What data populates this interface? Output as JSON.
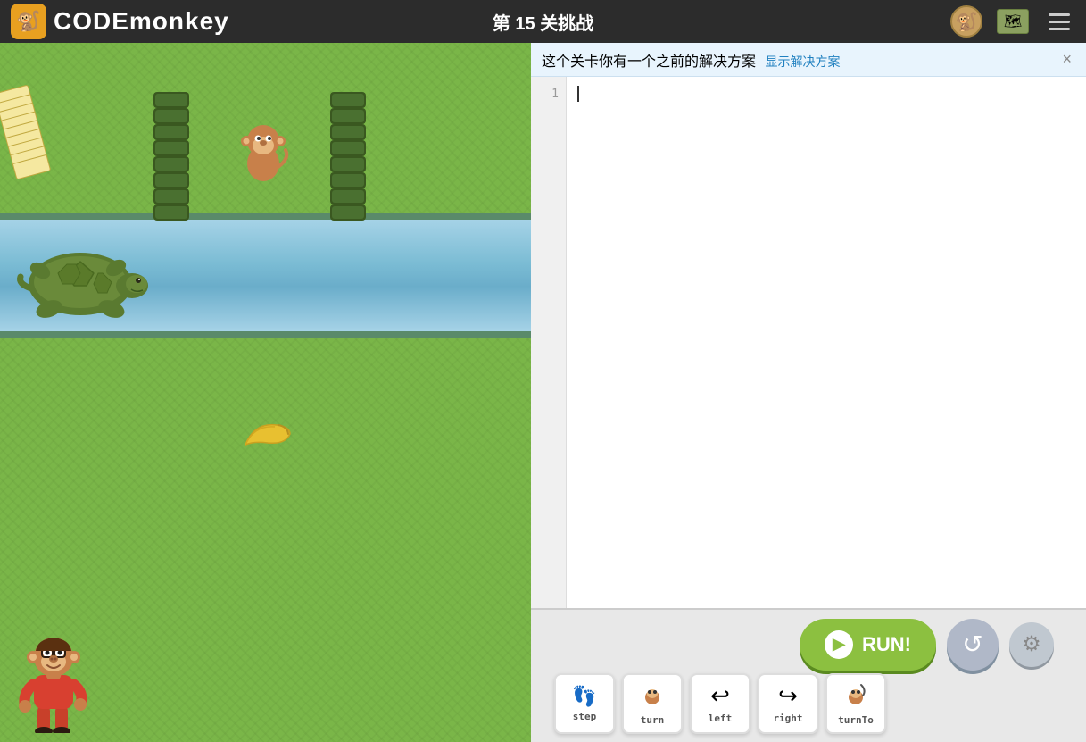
{
  "header": {
    "logo_monkey": "🐒",
    "logo_code": "CODE",
    "logo_monkey2": "monkey",
    "level_label": "第",
    "level_number": "15",
    "level_suffix": "关挑战"
  },
  "notification": {
    "text": "这个关卡你有一个之前的解决方案",
    "link_text": "显示解决方案",
    "close_label": "×"
  },
  "editor": {
    "line_1": "1"
  },
  "controls": {
    "run_label": "RUN!",
    "reset_icon": "↺",
    "settings_icon": "⚙"
  },
  "commands": [
    {
      "icon": "👣",
      "label": "step"
    },
    {
      "icon": "🐚",
      "label": "turn"
    },
    {
      "icon": "↩",
      "label": "left"
    },
    {
      "icon": "↪",
      "label": "right"
    },
    {
      "icon": "🔄",
      "label": "turnTo"
    }
  ]
}
